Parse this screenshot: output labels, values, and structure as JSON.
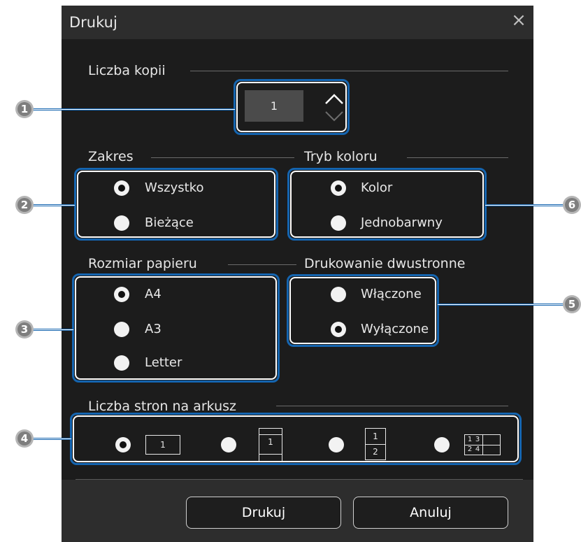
{
  "dialog": {
    "title": "Drukuj"
  },
  "copies": {
    "label": "Liczba kopii",
    "value": "1"
  },
  "range": {
    "label": "Zakres",
    "options": [
      "Wszystko",
      "Bieżące"
    ],
    "selected": "Wszystko"
  },
  "color_mode": {
    "label": "Tryb koloru",
    "options": [
      "Kolor",
      "Jednobarwny"
    ],
    "selected": "Kolor"
  },
  "paper_size": {
    "label": "Rozmiar papieru",
    "options": [
      "A4",
      "A3",
      "Letter"
    ],
    "selected": "A4"
  },
  "duplex": {
    "label": "Drukowanie dwustronne",
    "options": [
      "Włączone",
      "Wyłączone"
    ],
    "selected": "Wyłączone"
  },
  "pages_per_sheet": {
    "label": "Liczba stron na arkusz",
    "selected": "1",
    "icon_digits": {
      "a": "1",
      "b": "1",
      "c1": "1",
      "c2": "2",
      "d1": "1",
      "d2": "3",
      "d3": "2",
      "d4": "4"
    }
  },
  "buttons": {
    "print": "Drukuj",
    "cancel": "Anuluj"
  },
  "callouts": [
    "1",
    "2",
    "3",
    "4",
    "5",
    "6"
  ],
  "colors": {
    "dialog_bg": "#1c1c1c",
    "titlebar_bg": "#2d2d2d",
    "highlight": "#1565b0",
    "callout": "#7e7e7e"
  }
}
